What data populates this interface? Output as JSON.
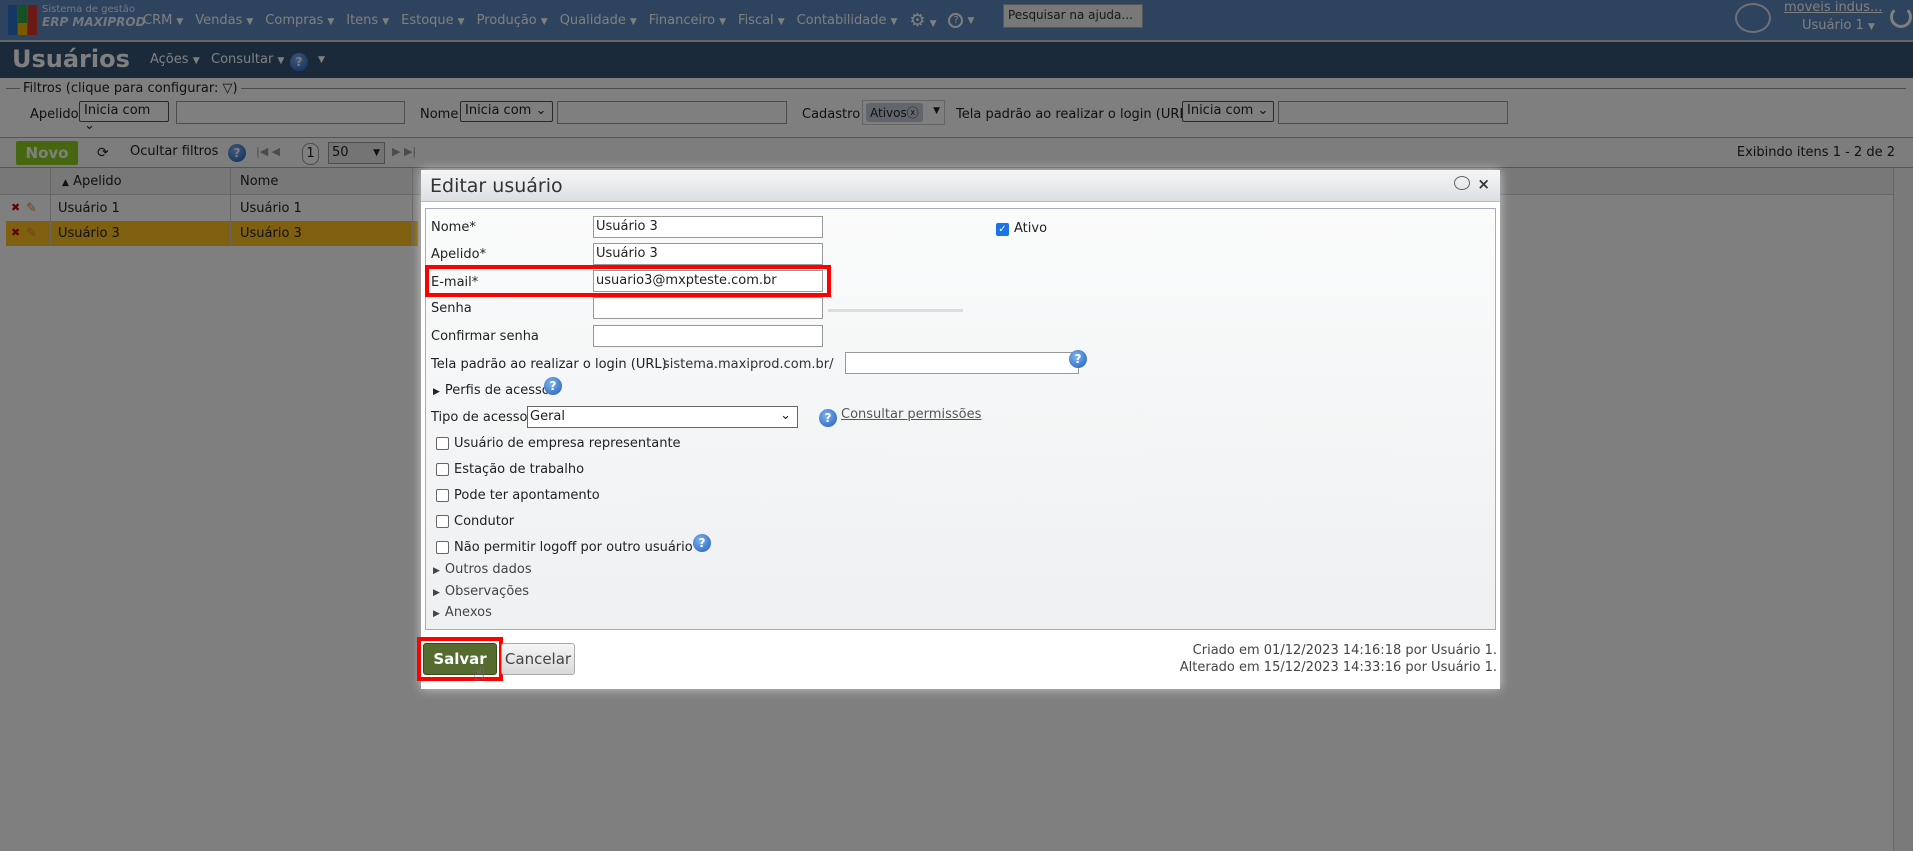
{
  "app": {
    "brand_line1": "Sistema de gestão",
    "brand_line2": "ERP MAXIPROD",
    "help_search_placeholder": "Pesquisar na ajuda...",
    "company": "moveis indus...",
    "user": "Usuário 1"
  },
  "menu": [
    "CRM",
    "Vendas",
    "Compras",
    "Itens",
    "Estoque",
    "Produção",
    "Qualidade",
    "Financeiro",
    "Fiscal",
    "Contabilidade"
  ],
  "page": {
    "title": "Usuários",
    "actions": "Ações",
    "consult": "Consultar"
  },
  "filters": {
    "legend": "Filtros (clique para configurar:",
    "apelido_label": "Apelido",
    "apelido_op": "Inicia com",
    "nome_label": "Nome",
    "nome_op": "Inicia com",
    "cadastro_label": "Cadastro",
    "cadastro_tag": "Ativos",
    "url_label": "Tela padrão ao realizar o login (URL)",
    "url_op": "Inicia com"
  },
  "toolbar": {
    "new": "Novo",
    "hide_filters": "Ocultar filtros",
    "page": "1",
    "page_size": "50",
    "showing": "Exibindo itens 1 - 2 de 2"
  },
  "grid": {
    "columns": [
      "Apelido",
      "Nome"
    ],
    "rows": [
      {
        "apelido": "Usuário 1",
        "nome": "Usuário 1"
      },
      {
        "apelido": "Usuário 3",
        "nome": "Usuário 3"
      }
    ]
  },
  "dialog": {
    "title": "Editar usuário",
    "fields": {
      "nome_label": "Nome*",
      "nome": "Usuário 3",
      "apelido_label": "Apelido*",
      "apelido": "Usuário 3",
      "email_label": "E-mail*",
      "email": "usuario3@mxpteste.com.br",
      "senha_label": "Senha",
      "confirmar_label": "Confirmar senha",
      "url_label": "Tela padrão ao realizar o login (URL)",
      "url_prefix": "sistema.maxiprod.com.br/",
      "ativo_label": "Ativo"
    },
    "perfis": "Perfis de acesso",
    "tipo_label": "Tipo de acesso",
    "tipo_value": "Geral",
    "consultar_permissoes": "Consultar permissões",
    "checkboxes": [
      "Usuário de empresa representante",
      "Estação de trabalho",
      "Pode ter apontamento",
      "Condutor",
      "Não permitir logoff por outro usuário"
    ],
    "sections": [
      "Outros dados",
      "Observações",
      "Anexos"
    ],
    "save": "Salvar",
    "cancel": "Cancelar",
    "created": "Criado em 01/12/2023 14:16:18 por Usuário 1.",
    "modified": "Alterado em 15/12/2023 14:33:16 por Usuário 1."
  }
}
